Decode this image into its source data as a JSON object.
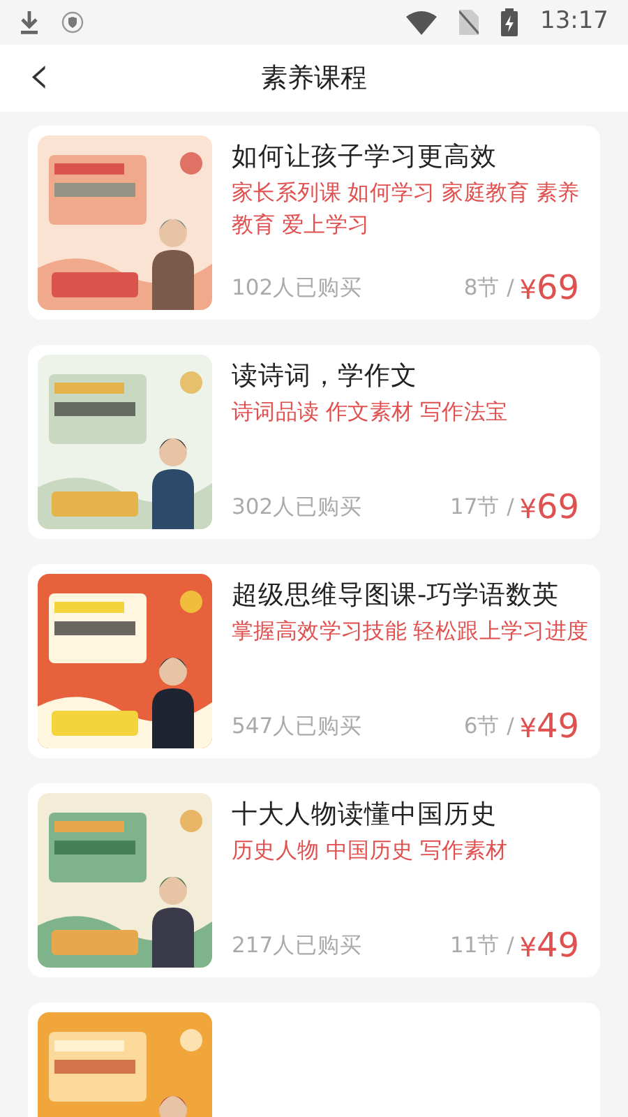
{
  "status_bar": {
    "time": "13:17"
  },
  "header": {
    "back": "‹",
    "title": "素养课程"
  },
  "courses": [
    {
      "thumbnail": {
        "kind": "picture"
      },
      "title": "如何让孩子学习更高效",
      "tags": "家长系列课 如何学习 家庭教育 素养教育 爱上学习",
      "buyers": "102人已购买",
      "lessons": "8节 /",
      "currency": "¥",
      "amount": "69"
    },
    {
      "thumbnail": {
        "kind": "picture"
      },
      "title": "读诗词，学作文",
      "tags": "诗词品读 作文素材 写作法宝",
      "buyers": "302人已购买",
      "lessons": "17节 /",
      "currency": "¥",
      "amount": "69"
    },
    {
      "thumbnail": {
        "kind": "picture"
      },
      "title": "超级思维导图课-巧学语数英",
      "tags": "掌握高效学习技能 轻松跟上学习进度",
      "buyers": "547人已购买",
      "lessons": "6节 /",
      "currency": "¥",
      "amount": "49"
    },
    {
      "thumbnail": {
        "kind": "picture"
      },
      "title": "十大人物读懂中国历史",
      "tags": "历史人物 中国历史 写作素材",
      "buyers": "217人已购买",
      "lessons": "11节 /",
      "currency": "¥",
      "amount": "49"
    },
    {
      "thumbnail": {
        "kind": "picture"
      }
    }
  ]
}
